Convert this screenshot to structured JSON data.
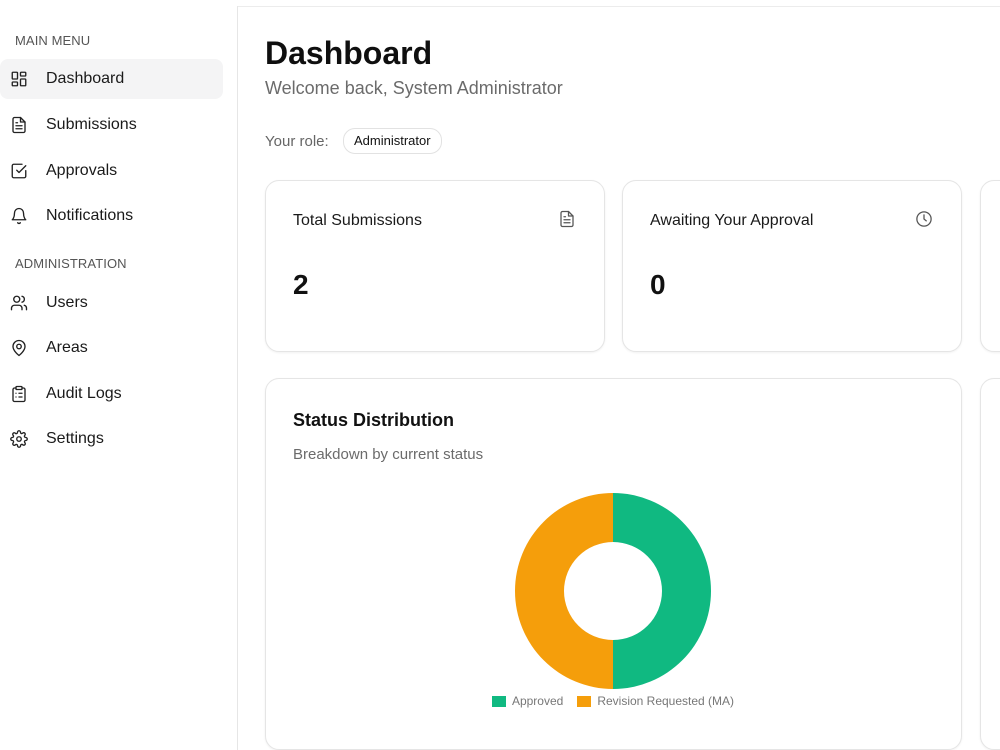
{
  "sidebar": {
    "sections": [
      {
        "title": "MAIN MENU",
        "items": [
          {
            "label": "Dashboard",
            "icon": "dashboard-grid-icon",
            "active": true
          },
          {
            "label": "Submissions",
            "icon": "file-text-icon"
          },
          {
            "label": "Approvals",
            "icon": "checkbox-icon"
          },
          {
            "label": "Notifications",
            "icon": "bell-icon"
          }
        ]
      },
      {
        "title": "ADMINISTRATION",
        "items": [
          {
            "label": "Users",
            "icon": "users-icon"
          },
          {
            "label": "Areas",
            "icon": "map-pin-icon"
          },
          {
            "label": "Audit Logs",
            "icon": "clipboard-list-icon"
          },
          {
            "label": "Settings",
            "icon": "gear-icon"
          }
        ]
      }
    ]
  },
  "header": {
    "title": "Dashboard",
    "welcome": "Welcome back, System Administrator",
    "role_label": "Your role:",
    "role_value": "Administrator"
  },
  "stats": [
    {
      "title": "Total Submissions",
      "value": "2",
      "icon": "file-text-icon"
    },
    {
      "title": "Awaiting Your Approval",
      "value": "0",
      "icon": "clock-icon"
    }
  ],
  "status_card": {
    "title": "Status Distribution",
    "subtitle": "Breakdown by current status"
  },
  "chart_data": {
    "type": "pie",
    "donut": true,
    "categories": [
      "Approved",
      "Revision Requested (MA)"
    ],
    "values": [
      1,
      1
    ],
    "colors": [
      "#10b981",
      "#f59e0b"
    ],
    "legend": "bottom"
  }
}
